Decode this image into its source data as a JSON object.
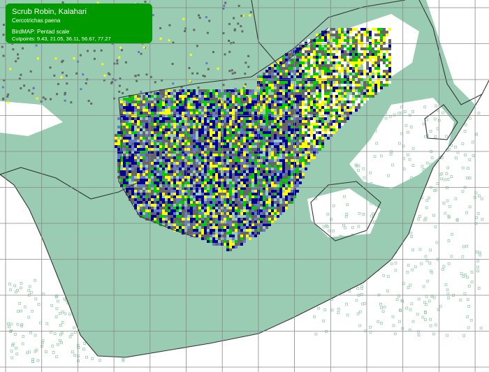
{
  "legend": {
    "common_name": "Scrub Robin, Kalahari",
    "scientific_name": "Cercotrichas paena",
    "scale_label": "BirdMAP: Pentad scale",
    "cutpoints_label": "Cutpoints: 9.43, 21.05, 36.11, 56.67, 77.27"
  },
  "map": {
    "cutpoints": [
      9.43,
      21.05,
      36.11,
      56.67,
      77.27
    ],
    "colors": {
      "land_unsurveyed": "#ffffff",
      "surveyed_absent": "#99ccb3",
      "range_grey": "#666666",
      "reporting_low": "#ffff00",
      "reporting_mid_low": "#00cc00",
      "reporting_mid": "#6677cc",
      "reporting_high": "#000099",
      "gridline": "#888888",
      "boundary": "#333333",
      "legend_background": "#009900",
      "legend_text": "#ffffff"
    }
  }
}
